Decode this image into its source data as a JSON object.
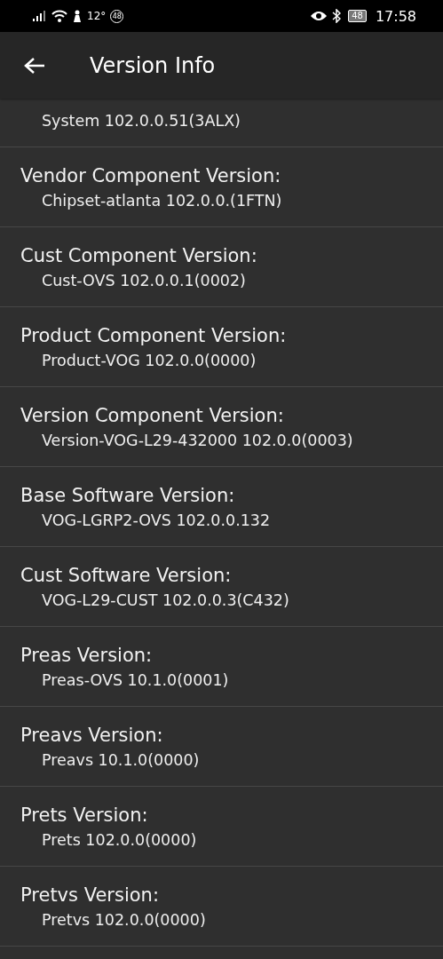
{
  "status_bar": {
    "temperature": "12°",
    "notification_count": "48",
    "battery_level": "48",
    "time": "17:58"
  },
  "toolbar": {
    "title": "Version Info"
  },
  "items": [
    {
      "value": "System 102.0.0.51(3ALX)"
    },
    {
      "title": "Vendor Component Version:",
      "value": "Chipset-atlanta 102.0.0.(1FTN)"
    },
    {
      "title": "Cust Component Version:",
      "value": "Cust-OVS 102.0.0.1(0002)"
    },
    {
      "title": "Product Component Version:",
      "value": "Product-VOG 102.0.0(0000)"
    },
    {
      "title": "Version Component Version:",
      "value": "Version-VOG-L29-432000 102.0.0(0003)"
    },
    {
      "title": "Base Software Version:",
      "value": "VOG-LGRP2-OVS 102.0.0.132"
    },
    {
      "title": "Cust Software Version:",
      "value": "VOG-L29-CUST 102.0.0.3(C432)"
    },
    {
      "title": "Preas Version:",
      "value": "Preas-OVS 10.1.0(0001)"
    },
    {
      "title": "Preavs Version:",
      "value": "Preavs 10.1.0(0000)"
    },
    {
      "title": "Prets Version:",
      "value": "Prets 102.0.0(0000)"
    },
    {
      "title": "Pretvs Version:",
      "value": "Pretvs 102.0.0(0000)"
    }
  ]
}
